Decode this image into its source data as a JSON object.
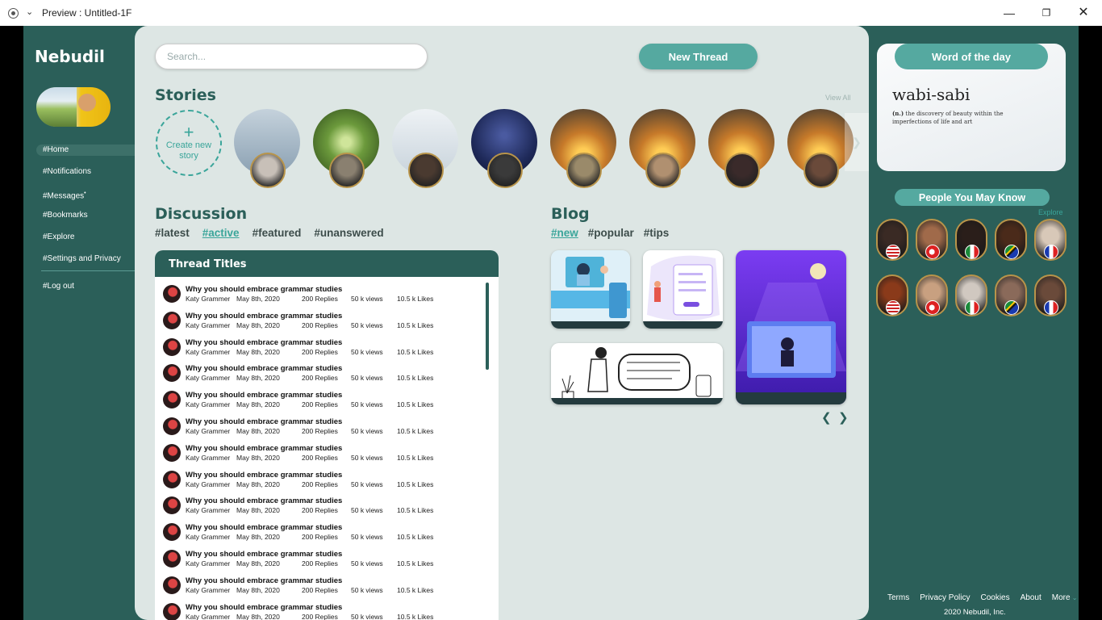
{
  "window": {
    "title": "Preview : Untitled-1F"
  },
  "app": {
    "brand": "Nebudil"
  },
  "sidebar": {
    "items": [
      {
        "label": "#Home",
        "active": true
      },
      {
        "label": "#Notifications"
      },
      {
        "label": "#Messages",
        "badge": "•"
      },
      {
        "label": "#Bookmarks"
      },
      {
        "label": "#Explore"
      },
      {
        "label": "#Settings and Privacy"
      },
      {
        "label": "#Log out"
      }
    ]
  },
  "header": {
    "search_placeholder": "Search...",
    "new_thread_label": "New Thread"
  },
  "stories": {
    "title": "Stories",
    "view_all": "View All",
    "create_label": "Create new story",
    "items": [
      {
        "bg": "#aebfcc",
        "mini": "#c8c0b8"
      },
      {
        "bg": "#6c9a3c",
        "mini": "#8a8070"
      },
      {
        "bg": "#d9e0e6",
        "mini": "#4a3a30"
      },
      {
        "bg": "#1f2a5a",
        "mini": "#3a3a3a"
      },
      {
        "bg": "#c77a2a",
        "mini": "#9a8a6a"
      },
      {
        "bg": "#c77a2a",
        "mini": "#b09070"
      },
      {
        "bg": "#c77a2a",
        "mini": "#3a2a2a"
      },
      {
        "bg": "#c77a2a",
        "mini": "#6a4a3a"
      }
    ]
  },
  "discussion": {
    "title": "Discussion",
    "tags": [
      {
        "label": "#latest"
      },
      {
        "label": "#active",
        "active": true
      },
      {
        "label": "#featured"
      },
      {
        "label": "#unanswered"
      }
    ],
    "table_header": "Thread Titles",
    "threads": [
      {
        "title": "Why you should embrace grammar studies",
        "author": "Katy Grammer",
        "date": "May 8th, 2020",
        "replies": "200 Replies",
        "views": "50 k views",
        "likes": "10.5 k Likes"
      },
      {
        "title": "Why you should embrace grammar studies",
        "author": "Katy Grammer",
        "date": "May 8th, 2020",
        "replies": "200 Replies",
        "views": "50 k views",
        "likes": "10.5 k Likes"
      },
      {
        "title": "Why you should embrace grammar studies",
        "author": "Katy Grammer",
        "date": "May 8th, 2020",
        "replies": "200 Replies",
        "views": "50 k views",
        "likes": "10.5 k Likes"
      },
      {
        "title": "Why you should embrace grammar studies",
        "author": "Katy Grammer",
        "date": "May 8th, 2020",
        "replies": "200 Replies",
        "views": "50 k views",
        "likes": "10.5 k Likes"
      },
      {
        "title": "Why you should embrace grammar studies",
        "author": "Katy Grammer",
        "date": "May 8th, 2020",
        "replies": "200 Replies",
        "views": "50 k views",
        "likes": "10.5 k Likes"
      },
      {
        "title": "Why you should embrace grammar studies",
        "author": "Katy Grammer",
        "date": "May 8th, 2020",
        "replies": "200 Replies",
        "views": "50 k views",
        "likes": "10.5 k Likes"
      },
      {
        "title": "Why you should embrace grammar studies",
        "author": "Katy Grammer",
        "date": "May 8th, 2020",
        "replies": "200 Replies",
        "views": "50 k views",
        "likes": "10.5 k Likes"
      },
      {
        "title": "Why you should embrace grammar studies",
        "author": "Katy Grammer",
        "date": "May 8th, 2020",
        "replies": "200 Replies",
        "views": "50 k views",
        "likes": "10.5 k Likes"
      },
      {
        "title": "Why you should embrace grammar studies",
        "author": "Katy Grammer",
        "date": "May 8th, 2020",
        "replies": "200 Replies",
        "views": "50 k views",
        "likes": "10.5 k Likes"
      },
      {
        "title": "Why you should embrace grammar studies",
        "author": "Katy Grammer",
        "date": "May 8th, 2020",
        "replies": "200 Replies",
        "views": "50 k views",
        "likes": "10.5 k Likes"
      },
      {
        "title": "Why you should embrace grammar studies",
        "author": "Katy Grammer",
        "date": "May 8th, 2020",
        "replies": "200 Replies",
        "views": "50 k views",
        "likes": "10.5 k Likes"
      },
      {
        "title": "Why you should embrace grammar studies",
        "author": "Katy Grammer",
        "date": "May 8th, 2020",
        "replies": "200 Replies",
        "views": "50 k views",
        "likes": "10.5 k Likes"
      },
      {
        "title": "Why you should embrace grammar studies",
        "author": "Katy Grammer",
        "date": "May 8th, 2020",
        "replies": "200 Replies",
        "views": "50 k views",
        "likes": "10.5 k Likes"
      }
    ]
  },
  "blog": {
    "title": "Blog",
    "tags": [
      {
        "label": "#new",
        "active": true
      },
      {
        "label": "#popular"
      },
      {
        "label": "#tips"
      }
    ]
  },
  "word_of_day": {
    "label": "Word of the day",
    "word": "wabi-sabi",
    "pos": "(n.)",
    "definition": "the discovery of beauty within the imperfections of life and art"
  },
  "people": {
    "label": "People You May Know",
    "explore": "Explore",
    "flags": [
      "usa-flag",
      "turkey-flag",
      "italy-flag",
      "south-africa-flag",
      "france-flag",
      "usa-flag",
      "turkey-flag",
      "italy-flag",
      "south-africa-flag",
      "france-flag"
    ]
  },
  "footer": {
    "links": [
      "Terms",
      "Privacy Policy",
      "Cookies",
      "About",
      "More"
    ],
    "copyright": "2020 Nebudil, Inc."
  },
  "colors": {
    "primary": "#2b5f59",
    "accent": "#55a9a0",
    "link": "#3aa59a"
  }
}
